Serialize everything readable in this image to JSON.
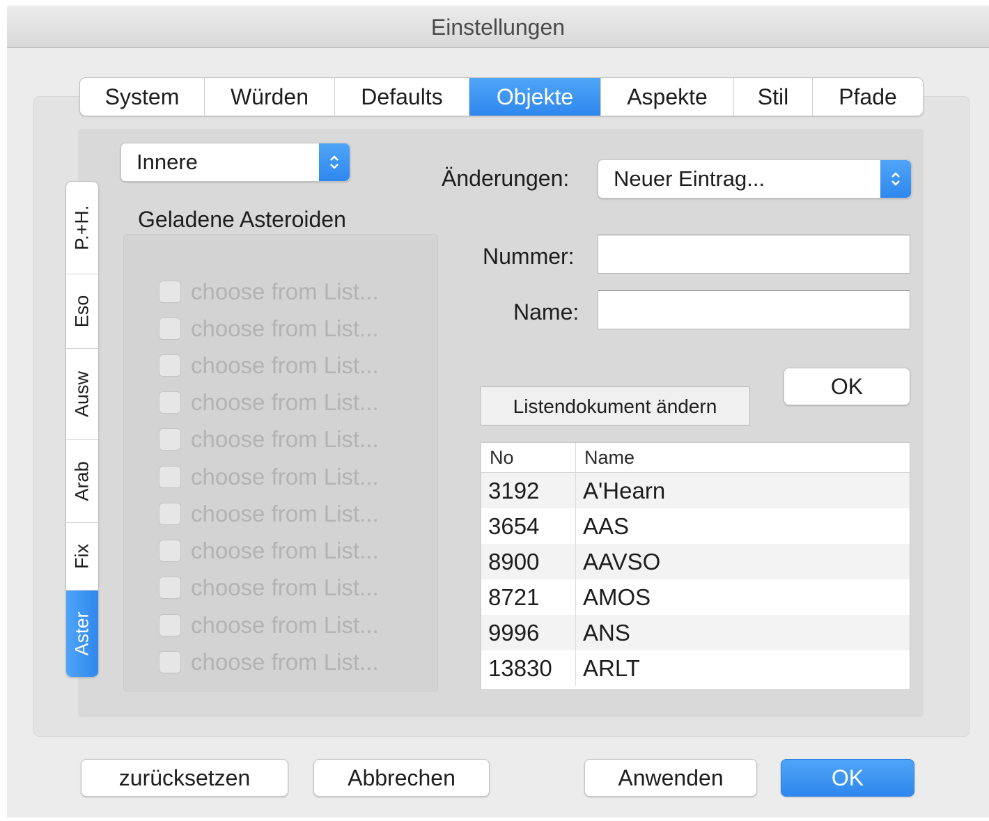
{
  "window": {
    "title": "Einstellungen"
  },
  "tabs": [
    {
      "label": "System"
    },
    {
      "label": "Würden"
    },
    {
      "label": "Defaults"
    },
    {
      "label": "Objekte",
      "active": true
    },
    {
      "label": "Aspekte"
    },
    {
      "label": "Stil"
    },
    {
      "label": "Pfade"
    }
  ],
  "side_tabs": [
    {
      "label": "P.+H."
    },
    {
      "label": "Eso"
    },
    {
      "label": "Ausw"
    },
    {
      "label": "Arab"
    },
    {
      "label": "Fix"
    },
    {
      "label": "Aster",
      "active": true
    }
  ],
  "category_select": {
    "value": "Innere"
  },
  "asteroids": {
    "title": "Geladene Asteroiden",
    "items": [
      "choose from List...",
      "choose from List...",
      "choose from List...",
      "choose from List...",
      "choose from List...",
      "choose from List...",
      "choose from List...",
      "choose from List...",
      "choose from List...",
      "choose from List...",
      "choose from List..."
    ]
  },
  "changes": {
    "label": "Änderungen:",
    "value": "Neuer Eintrag..."
  },
  "nummer": {
    "label": "Nummer:",
    "value": ""
  },
  "name": {
    "label": "Name:",
    "value": ""
  },
  "ok_small_label": "OK",
  "list_doc_button": "Listendokument ändern",
  "table": {
    "columns": [
      "No",
      "Name"
    ],
    "rows": [
      {
        "no": "3192",
        "name": "A'Hearn"
      },
      {
        "no": "3654",
        "name": "AAS"
      },
      {
        "no": "8900",
        "name": "AAVSO"
      },
      {
        "no": "8721",
        "name": "AMOS"
      },
      {
        "no": "9996",
        "name": "ANS"
      },
      {
        "no": "13830",
        "name": "ARLT"
      }
    ]
  },
  "footer": {
    "reset": "zurücksetzen",
    "cancel": "Abbrechen",
    "apply": "Anwenden",
    "ok": "OK"
  },
  "colors": {
    "accent": "#2f87ee",
    "window_bg": "#ececec"
  }
}
